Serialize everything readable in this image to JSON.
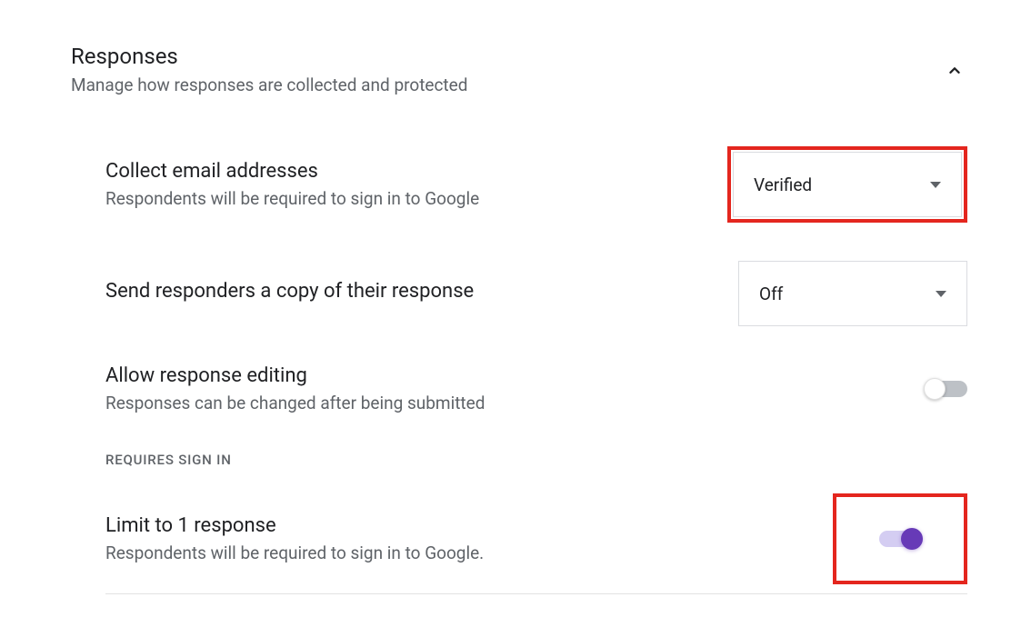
{
  "section": {
    "title": "Responses",
    "subtitle": "Manage how responses are collected and protected"
  },
  "items": {
    "collect_email": {
      "title": "Collect email addresses",
      "desc": "Respondents will be required to sign in to Google",
      "value": "Verified"
    },
    "send_copy": {
      "title": "Send responders a copy of their response",
      "value": "Off"
    },
    "allow_editing": {
      "title": "Allow response editing",
      "desc": "Responses can be changed after being submitted",
      "state": "off"
    },
    "subheader": "REQUIRES SIGN IN",
    "limit_one": {
      "title": "Limit to 1 response",
      "desc": "Respondents will be required to sign in to Google.",
      "state": "on"
    }
  }
}
